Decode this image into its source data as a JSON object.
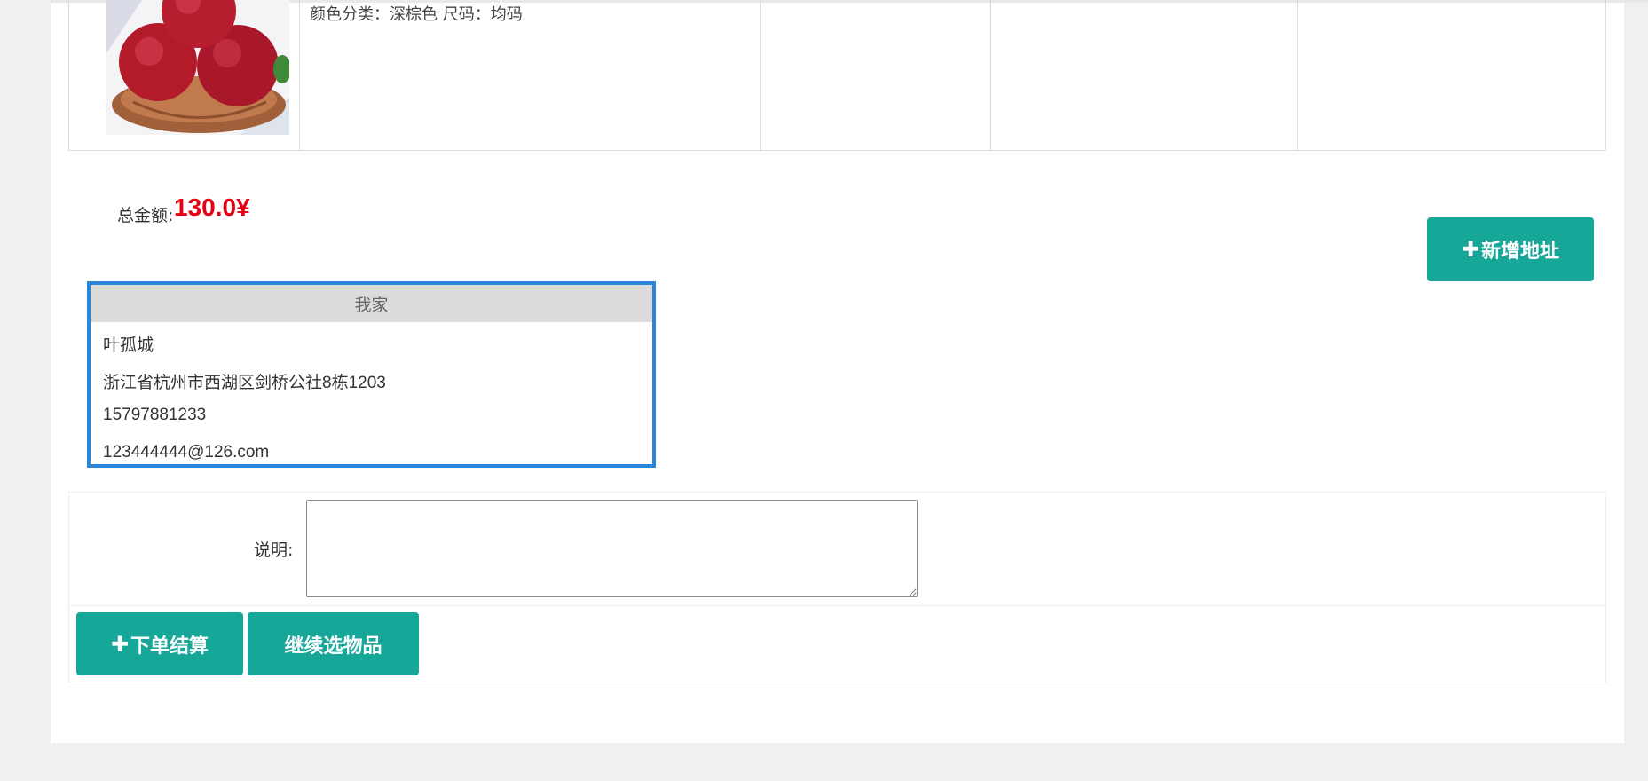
{
  "product": {
    "spec": "颜色分类：深棕色 尺码：均码",
    "image_icon": "apple-basket-photo"
  },
  "summary": {
    "total_label": "总金额:",
    "total_value": "130.0¥"
  },
  "actions": {
    "add_address_label": "新增地址",
    "submit_label": "下单结算",
    "continue_label": "继续选物品",
    "plus_icon": "plus-icon"
  },
  "address": {
    "title": "我家",
    "name": "叶孤城",
    "detail": "浙江省杭州市西湖区剑桥公社8栋1203",
    "phone": "15797881233",
    "email": "123444444@126.com"
  },
  "form": {
    "description_label": "说明:",
    "description_value": ""
  },
  "colors": {
    "accent": "#17a799",
    "price": "#e60012",
    "selected_border": "#2b86d9"
  }
}
